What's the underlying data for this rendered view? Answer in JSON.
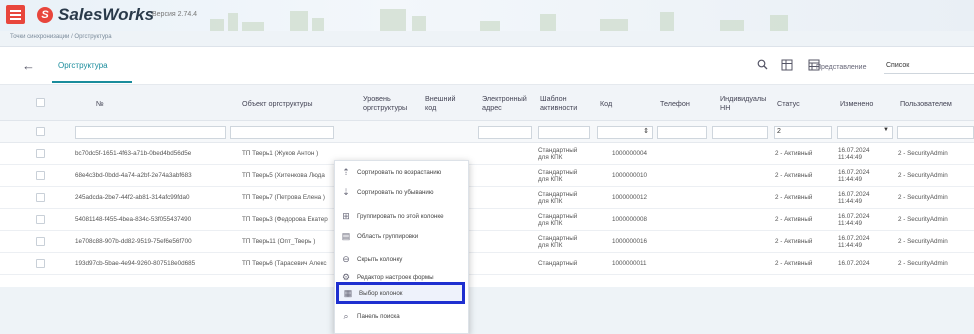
{
  "header": {
    "app_name": "SalesWorks",
    "version": "Версия 2.74.4",
    "logo_letter": "S"
  },
  "breadcrumb": "Точки синхронизации / Оргструктура",
  "toolbar": {
    "back_icon": "arrow-left-icon",
    "active_tab": "Оргструктура",
    "icons": [
      "search-icon",
      "filter-columns-icon",
      "group-icon"
    ],
    "view_label": "Представление",
    "view_value": "Список"
  },
  "table": {
    "columns": [
      "№",
      "Объект оргструктуры",
      "Уровень оргструктуры",
      "Внешний код",
      "Электронный адрес",
      "Шаблон активности",
      "Код",
      "Телефон",
      "Индивидуальный НН",
      "Статус",
      "Изменено",
      "Пользователем"
    ],
    "filters": {
      "status": "2"
    },
    "rows": [
      {
        "num": "bc70dc5f-1651-4f63-a71b-0bed4bd56d5e",
        "object": "ТП Тверь1 (Жуков Антон )",
        "template": "Стандартный для КПК",
        "code": "1000000004",
        "status": "2 - Активный",
        "changed": "16.07.2024 11:44:49",
        "user": "2 - SecurityAdmin"
      },
      {
        "num": "68e4c3bd-0bdd-4a74-a2bf-2e74a3abf683",
        "object": "ТП Тверь5 (Хитенкова Люда",
        "template": "Стандартный для КПК",
        "code": "1000000010",
        "status": "2 - Активный",
        "changed": "16.07.2024 11:44:49",
        "user": "2 - SecurityAdmin"
      },
      {
        "num": "245adcda-2be7-44f2-ab81-314afc99fda0",
        "object": "ТП Тверь7 (Петрова Елена )",
        "template": "Стандартный для КПК",
        "code": "1000000012",
        "status": "2 - Активный",
        "changed": "16.07.2024 11:44:49",
        "user": "2 - SecurityAdmin"
      },
      {
        "num": "54081148-f455-4bea-834c-53f055437490",
        "object": "ТП Тверь3 (Федорова Екатер",
        "template": "Стандартный для КПК",
        "code": "1000000008",
        "status": "2 - Активный",
        "changed": "16.07.2024 11:44:49",
        "user": "2 - SecurityAdmin"
      },
      {
        "num": "1e708c88-907b-dd82-9519-75ef6e56f700",
        "object": "ТП Тверь11 (Опт_Тверь )",
        "template": "Стандартный для КПК",
        "code": "1000000016",
        "status": "2 - Активный",
        "changed": "16.07.2024 11:44:49",
        "user": "2 - SecurityAdmin"
      },
      {
        "num": "193d97cb-5bae-4e94-9260-807518e0d685",
        "object": "ТП Тверь6 (Тарасевич Алекс",
        "template": "Стандартный",
        "code": "1000000011",
        "status": "2 - Активный",
        "changed": "16.07.2024",
        "user": "2 - SecurityAdmin"
      }
    ]
  },
  "context_menu": {
    "items": [
      {
        "label": "Сортировать по возрастанию",
        "icon": "sort-asc-icon"
      },
      {
        "label": "Сортировать по убыванию",
        "icon": "sort-desc-icon"
      },
      {
        "label": "Группировать по этой колонке",
        "icon": "group-by-icon"
      },
      {
        "label": "Область группировки",
        "icon": "group-area-icon"
      },
      {
        "label": "Скрыть колонку",
        "icon": "hide-column-icon"
      },
      {
        "label": "Редактор настроек формы",
        "icon": "form-settings-icon"
      },
      {
        "label": "Выбор колонок",
        "icon": "column-chooser-icon"
      },
      {
        "label": "Панель поиска",
        "icon": "search-panel-icon"
      }
    ],
    "selected_index": 6
  },
  "colors": {
    "accent": "#1a8c9c",
    "brand": "#e8463c",
    "highlight": "#1e2fd0"
  }
}
